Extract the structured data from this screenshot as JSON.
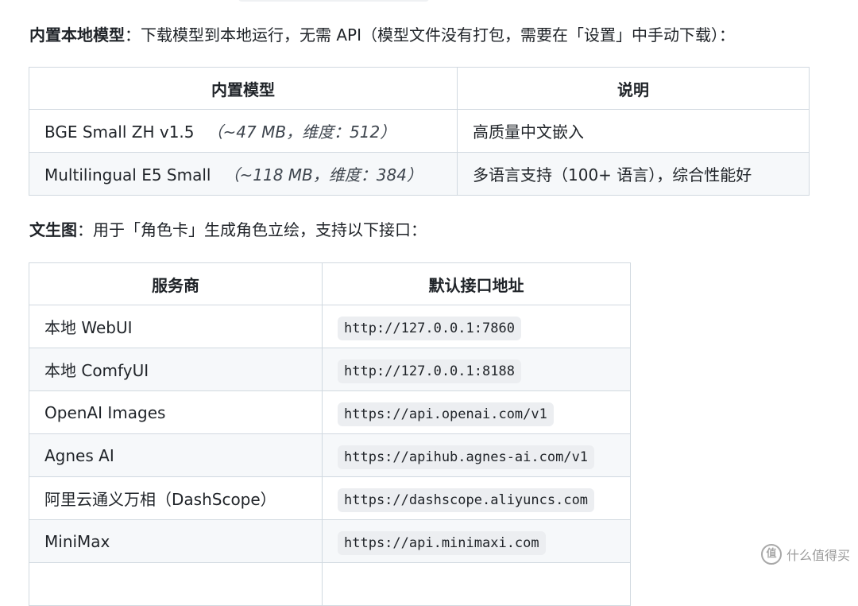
{
  "intro": {
    "bold": "内置本地模型",
    "rest": "：下载模型到本地运行，无需 API（模型文件没有打包，需要在「设置」中手动下载）："
  },
  "builtin_models": {
    "headers": [
      "内置模型",
      "说明"
    ],
    "rows": [
      {
        "name": "BGE Small ZH v1.5",
        "note": "（~47 MB，维度：512）",
        "desc": "高质量中文嵌入"
      },
      {
        "name": "Multilingual E5 Small",
        "note": "（~118 MB，维度：384）",
        "desc": "多语言支持（100+ 语言），综合性能好"
      }
    ]
  },
  "t2i_intro": {
    "bold": "文生图",
    "rest": "：用于「角色卡」生成角色立绘，支持以下接口："
  },
  "providers": {
    "headers": [
      "服务商",
      "默认接口地址"
    ],
    "rows": [
      {
        "name": "本地 WebUI",
        "url": "http://127.0.0.1:7860"
      },
      {
        "name": "本地 ComfyUI",
        "url": "http://127.0.0.1:8188"
      },
      {
        "name": "OpenAI Images",
        "url": "https://api.openai.com/v1"
      },
      {
        "name": "Agnes AI",
        "url": "https://apihub.agnes-ai.com/v1"
      },
      {
        "name": "阿里云通义万相（DashScope）",
        "url": "https://dashscope.aliyuncs.com"
      },
      {
        "name": "MiniMax",
        "url": "https://api.minimaxi.com"
      }
    ]
  },
  "watermark": {
    "icon": "值",
    "text": "什么值得买"
  }
}
